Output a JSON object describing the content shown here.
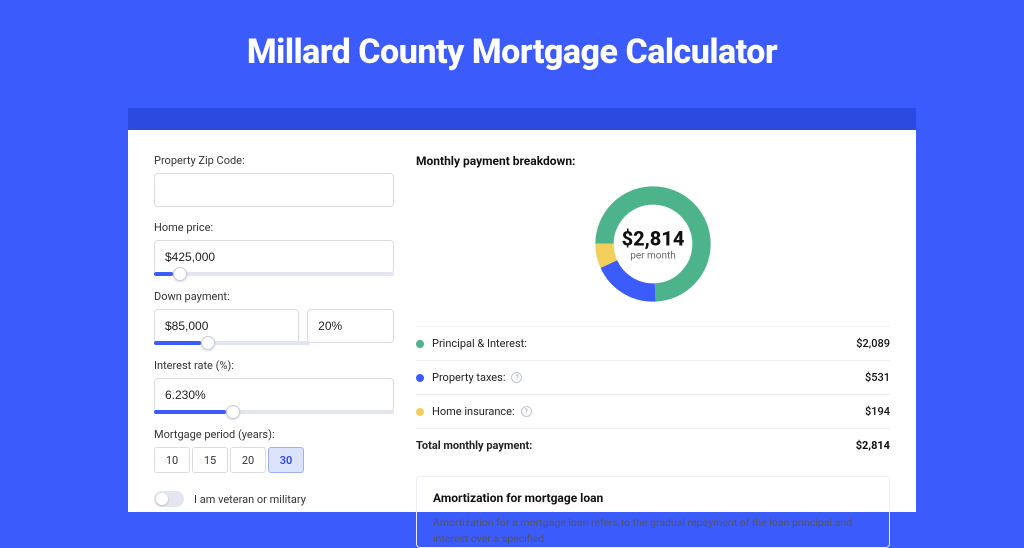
{
  "title": "Millard County Mortgage Calculator",
  "form": {
    "zip_label": "Property Zip Code:",
    "zip_value": "",
    "home_price_label": "Home price:",
    "home_price_value": "$425,000",
    "down_payment_label": "Down payment:",
    "down_payment_value": "$85,000",
    "down_payment_pct": "20%",
    "interest_label": "Interest rate (%):",
    "interest_value": "6.230%",
    "period_label": "Mortgage period (years):",
    "period_options": [
      "10",
      "15",
      "20",
      "30"
    ],
    "period_selected": "30",
    "veteran_label": "I am veteran or military"
  },
  "breakdown": {
    "title": "Monthly payment breakdown:",
    "center_amount": "$2,814",
    "center_sub": "per month",
    "rows": [
      {
        "label": "Principal & Interest:",
        "value": "$2,089",
        "color": "#4cb38a",
        "info": false
      },
      {
        "label": "Property taxes:",
        "value": "$531",
        "color": "#3b5bfd",
        "info": true
      },
      {
        "label": "Home insurance:",
        "value": "$194",
        "color": "#f2cf5b",
        "info": true
      }
    ],
    "total_label": "Total monthly payment:",
    "total_value": "$2,814"
  },
  "amort": {
    "title": "Amortization for mortgage loan",
    "text": "Amortization for a mortgage loan refers to the gradual repayment of the loan principal and interest over a specified"
  },
  "chart_data": {
    "type": "pie",
    "title": "Monthly payment breakdown",
    "categories": [
      "Principal & Interest",
      "Property taxes",
      "Home insurance"
    ],
    "values": [
      2089,
      531,
      194
    ],
    "colors": [
      "#4cb38a",
      "#3b5bfd",
      "#f2cf5b"
    ],
    "total": 2814
  }
}
